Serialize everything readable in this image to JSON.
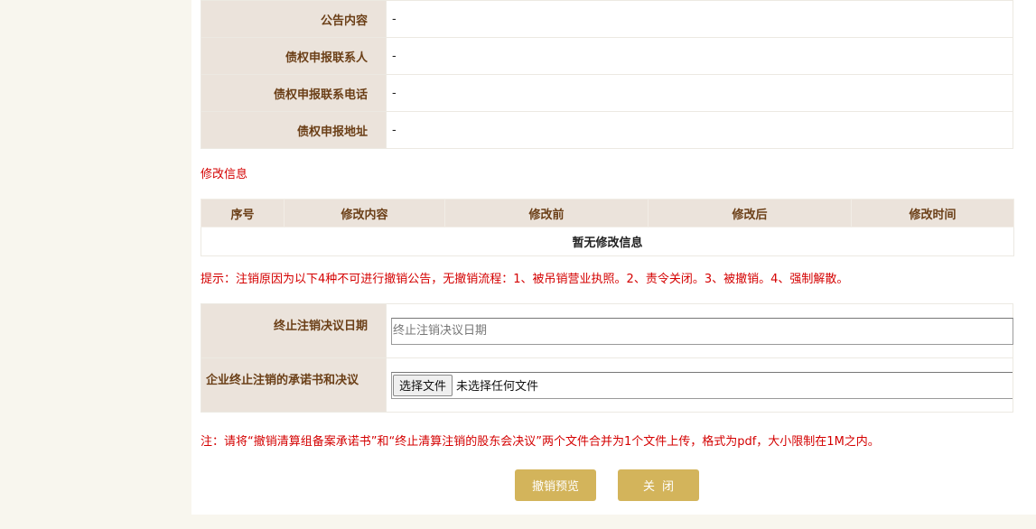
{
  "info_rows": [
    {
      "label": "公告内容",
      "value": "-"
    },
    {
      "label": "债权申报联系人",
      "value": "-"
    },
    {
      "label": "债权申报联系电话",
      "value": "-"
    },
    {
      "label": "债权申报地址",
      "value": "-"
    }
  ],
  "modify_section": {
    "title": "修改信息",
    "columns": [
      "序号",
      "修改内容",
      "修改前",
      "修改后",
      "修改时间"
    ],
    "empty_text": "暂无修改信息"
  },
  "tip": "提示：注销原因为以下4种不可进行撤销公告，无撤销流程：1、被吊销营业执照。2、责令关闭。3、被撤销。4、强制解散。",
  "form": {
    "date_label": "终止注销决议日期",
    "date_placeholder": "终止注销决议日期",
    "file_label": "企业终止注销的承诺书和决议",
    "file_button": "选择文件",
    "file_status": "未选择任何文件"
  },
  "note": "注：请将“撤销清算组备案承诺书”和“终止清算注销的股东会决议”两个文件合并为1个文件上传，格式为pdf，大小限制在1M之内。",
  "buttons": {
    "preview": "撤销预览",
    "close": "关闭"
  },
  "colors": {
    "accent_gold": "#d3b45b",
    "label_bg": "#ebe3db",
    "label_text": "#6b3f17",
    "warning_red": "#d40000"
  }
}
